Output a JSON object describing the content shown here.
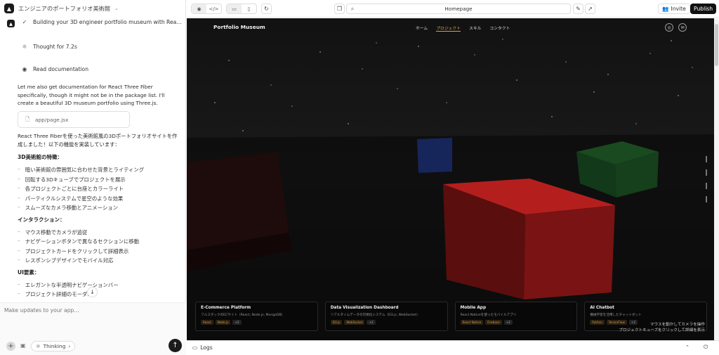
{
  "project": {
    "title": "エンジニアのポートフォリオ美術館"
  },
  "chat": {
    "steps": [
      {
        "label": "Building your 3D engineer portfolio museum with Rea...",
        "icon": "check-icon"
      },
      {
        "label": "Thought for 7.2s",
        "icon": "lightbulb-icon"
      },
      {
        "label": "Read documentation",
        "icon": "eye-icon"
      }
    ],
    "intro": "Let me also get documentation for React Three Fiber specifically, though it might not be in the package list. I'll create a beautiful 3D museum portfolio using Three.js.",
    "file": "app/page.jsx",
    "summary": "React Three Fiberを使った美術館風の3Dポートフォリオサイトを作成しました！以下の機能を実装しています：",
    "sections": [
      {
        "heading": "3D美術館の特徴：",
        "items": [
          "暗い美術館の雰囲気に合わせた背景とライティング",
          "回転する3Dキューブでプロジェクトを展示",
          "各プロジェクトごとに台座とカラーライト",
          "パーティクルシステムで星空のような効果",
          "スムーズなカメラ移動とアニメーション"
        ]
      },
      {
        "heading": "インタラクション：",
        "items": [
          "マウス移動でカメラが追従",
          "ナビゲーションボタンで異なるセクションに移動",
          "プロジェクトカードをクリックして詳細表示",
          "レスポンシブデザインでモバイル対応"
        ]
      },
      {
        "heading": "UI要素：",
        "items": [
          "エレガントな半透明ナビゲーションバー",
          "プロジェクト詳細のモーダル"
        ]
      }
    ],
    "composer": {
      "placeholder": "Make updates to your app...",
      "thinking": "Thinking"
    }
  },
  "toolbar": {
    "url": "Homepage",
    "invite": "Invite",
    "publish": "Publish"
  },
  "preview": {
    "brand": "Portfolio Museum",
    "nav": [
      "ホーム",
      "プロジェクト",
      "スキル",
      "コンタクト"
    ],
    "active_nav": "プロジェクト",
    "projects": [
      {
        "title": "E-Commerce Platform",
        "desc": "フルスタックのECサイト（React, Node.js, MongoDB）",
        "tags": [
          "React",
          "Node.js",
          "+2"
        ]
      },
      {
        "title": "Data Visualization Dashboard",
        "desc": "リアルタイムデータの可視化システム（D3.js, WebSocket）",
        "tags": [
          "D3.js",
          "WebSocket",
          "+2"
        ]
      },
      {
        "title": "Mobile App",
        "desc": "React Nativeを使ったモバイルアプリ",
        "tags": [
          "React Native",
          "Firebase",
          "+2"
        ]
      },
      {
        "title": "AI Chatbot",
        "desc": "機械学習を活用したチャットボット",
        "tags": [
          "Python",
          "TensorFlow",
          "+2"
        ]
      }
    ],
    "hint_line1": "マウスを動かしてカメラを操作",
    "hint_line2": "プロジェクトキューブをクリックして詳細を表示",
    "colors": {
      "accent": "#d7a24b",
      "cube_red": "#b0201f",
      "cube_green": "#1f5a24",
      "cube_blue": "#1a2e66"
    }
  },
  "bottom": {
    "logs": "Logs"
  }
}
